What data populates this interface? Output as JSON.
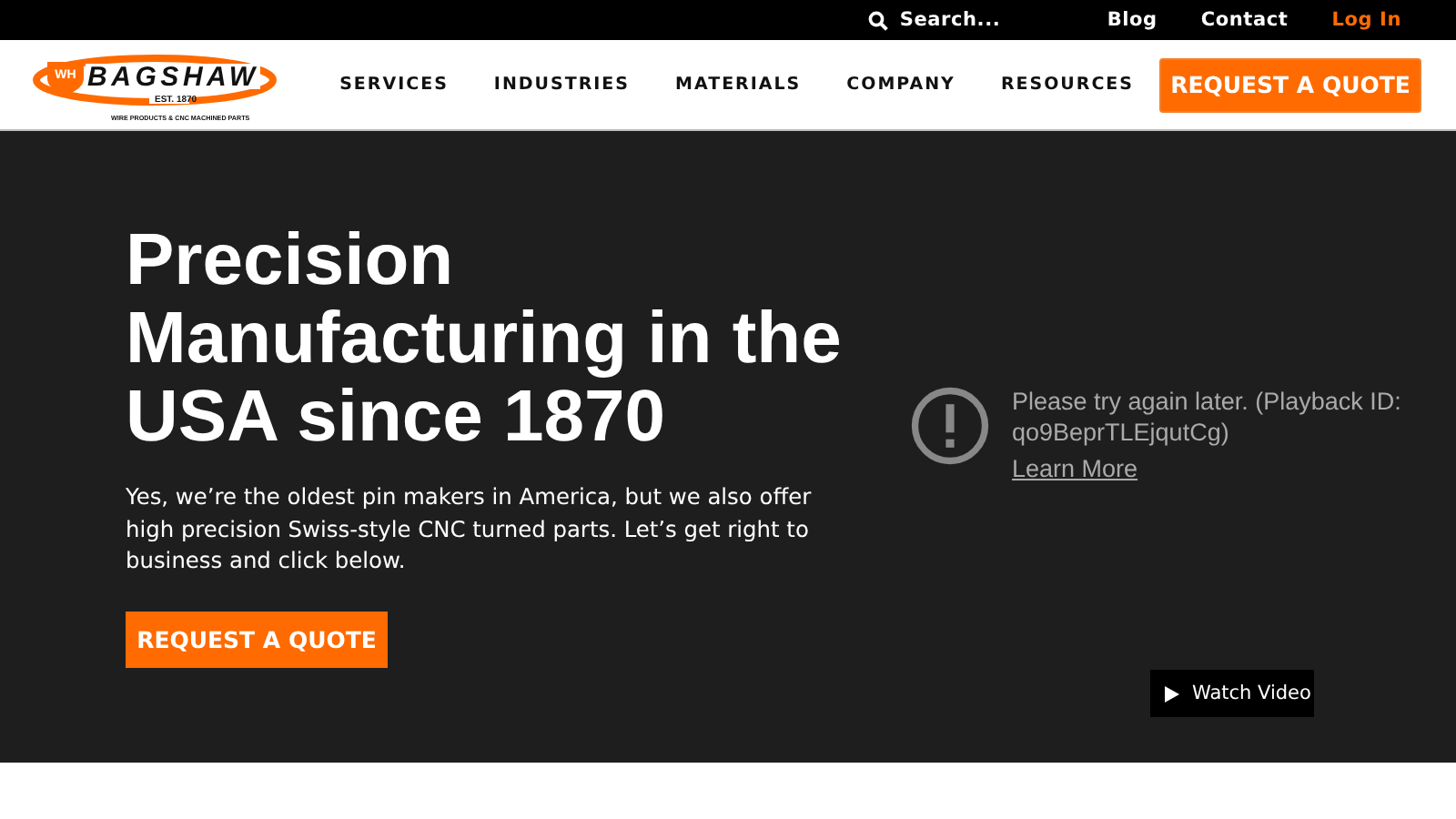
{
  "top_bar": {
    "search": {
      "placeholder": "Search..."
    },
    "links": [
      {
        "label": "Blog",
        "kind": "plain"
      },
      {
        "label": "Contact",
        "kind": "plain"
      },
      {
        "label": "Log In",
        "kind": "accent"
      }
    ]
  },
  "header": {
    "logo": {
      "badge": "WH",
      "name": "BAGSHAW",
      "established": "EST. 1870",
      "tagline": "WIRE PRODUCTS & CNC MACHINED PARTS"
    },
    "nav": [
      "SERVICES",
      "INDUSTRIES",
      "MATERIALS",
      "COMPANY",
      "RESOURCES"
    ],
    "cta": "REQUEST A QUOTE"
  },
  "hero": {
    "headline": "Precision Manufacturing in the USA since 1870",
    "body": "Yes, we’re the oldest pin makers in America, but we also offer high precision Swiss-style CNC turned parts. Let’s get right to business and click below.",
    "cta": "REQUEST A QUOTE",
    "video_error": {
      "message": "Please try again later. (Playback ID: qo9BeprTLEjqutCg)",
      "link": "Learn More"
    },
    "watch_button": "Watch Video"
  }
}
